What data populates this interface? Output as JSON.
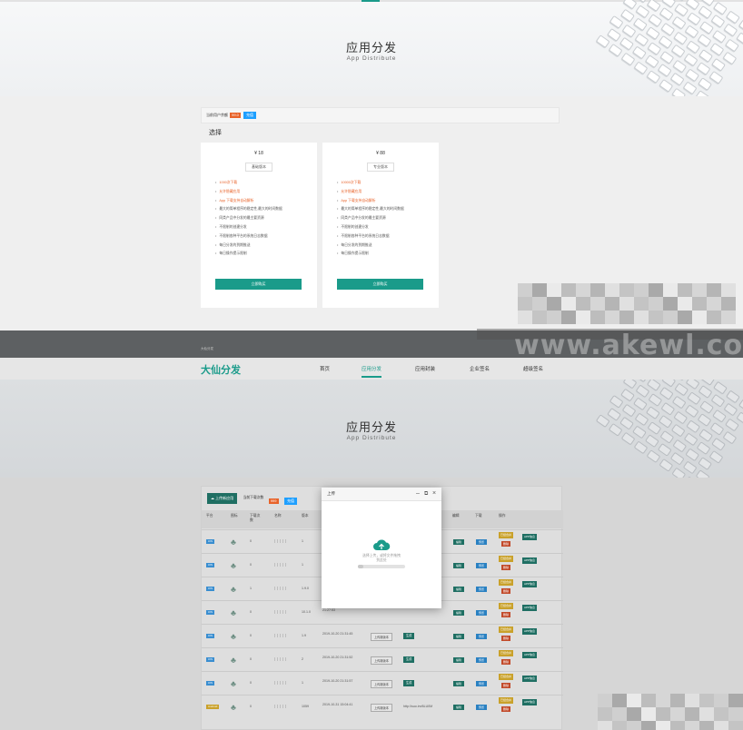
{
  "hero_top": {
    "title": "应用分发",
    "subtitle": "App Distribute"
  },
  "notice": {
    "text": "当前用户余额",
    "badge": "99.0",
    "button": "充值"
  },
  "choose_label": "选择",
  "plans": [
    {
      "price": "¥ 18",
      "version": "基础版本",
      "features": [
        "1000次下载",
        "允许隐藏应用",
        "App 下载支持自动解析",
        "最大的简单程序的稳定性,最大的时间数据",
        "同类产品中分发的最主要资源",
        "不限制的创建分发",
        "不限制各种平台的系统日志数据",
        "每日分发的到期推送",
        "每日操作提示限制"
      ],
      "buy": "立即购买"
    },
    {
      "price": "¥ 88",
      "version": "专业版本",
      "features": [
        "10000次下载",
        "允许隐藏应用",
        "App 下载支持自动解析",
        "最大的简单程序的稳定性,最大的时间数据",
        "同类产品中分发的最主要资源",
        "不限制的创建分发",
        "不限制各种平台的系统日志数据",
        "每日分发的到期推送",
        "每日操作提示限制"
      ],
      "buy": "立即购买"
    }
  ],
  "band_small": "大仙分发",
  "nav": {
    "brand": "大仙分发",
    "items": [
      "首页",
      "应用分发",
      "应用封装",
      "企业签名",
      "超级签名"
    ],
    "active_index": 1
  },
  "hero_bottom": {
    "title": "应用分发",
    "subtitle": "App Distribute"
  },
  "table": {
    "upload_button": "上传新应用",
    "count_label": "当前下载次数",
    "count_badge": "999",
    "recharge": "充值",
    "headers": [
      "平台",
      "图标",
      "下载次数",
      "名称",
      "版本",
      "上传时间",
      "上传新版本",
      "短链",
      "合并",
      "编辑",
      "下载",
      "操作"
    ],
    "rows": [
      {
        "platform": "iOS",
        "downloads": "0",
        "version": "1",
        "time": "",
        "action": "",
        "short": "",
        "edit": "编辑",
        "dl": "预览",
        "merge": "已经合并",
        "del": "删除",
        "info": "APP信息"
      },
      {
        "platform": "iOS",
        "downloads": "0",
        "version": "1",
        "time": "",
        "action": "",
        "short": "",
        "edit": "编辑",
        "dl": "预览",
        "merge": "已经合并",
        "del": "删除",
        "info": "APP信息"
      },
      {
        "platform": "iOS",
        "downloads": "1",
        "version": "1.9.0",
        "time": "",
        "action": "",
        "short": "",
        "edit": "编辑",
        "dl": "预览",
        "merge": "已经合并",
        "del": "删除",
        "info": "APP信息"
      },
      {
        "platform": "iOS",
        "downloads": "0",
        "version": "10.1.0",
        "time": "21:27:53",
        "action": "",
        "short": "",
        "edit": "编辑",
        "dl": "预览",
        "merge": "已经合并",
        "del": "删除",
        "info": "APP信息"
      },
      {
        "platform": "iOS",
        "downloads": "0",
        "version": "1.9",
        "time": "2019-10-20 21:31:45",
        "action": "上传新版本",
        "short": "生成",
        "edit": "编辑",
        "dl": "预览",
        "merge": "已经合并",
        "del": "删除",
        "info": "APP信息"
      },
      {
        "platform": "iOS",
        "downloads": "0",
        "version": "2",
        "time": "2019-10-20 21:31:52",
        "action": "上传新版本",
        "short": "生成",
        "edit": "编辑",
        "dl": "预览",
        "merge": "已经合并",
        "del": "删除",
        "info": "APP信息"
      },
      {
        "platform": "iOS",
        "downloads": "0",
        "version": "1",
        "time": "2019-10-20 21:31:57",
        "action": "上传新版本",
        "short": "生成",
        "edit": "编辑",
        "dl": "预览",
        "merge": "已经合并",
        "del": "删除",
        "info": "APP信息"
      },
      {
        "platform": "Android",
        "downloads": "0",
        "version": "1059",
        "time": "2019-10-31 15:04:41",
        "action": "上传新版本",
        "short": "http://suo.im/6LU0M",
        "edit": "编辑",
        "dl": "预览",
        "merge": "已经合并",
        "del": "删除",
        "info": "APP信息"
      }
    ]
  },
  "modal": {
    "title": "上传",
    "hint1": "选择上传，或将文件拖拽",
    "hint2": "到此处",
    "progress_percent": 12,
    "progress_text": "0%"
  },
  "watermark": "www.akewl.com",
  "colors": {
    "accent": "#1a9b8a",
    "orange": "#e8632a",
    "blue": "#1e9fff"
  }
}
